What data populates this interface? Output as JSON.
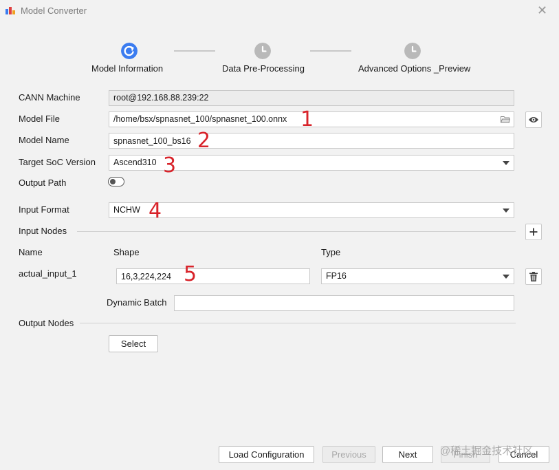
{
  "window": {
    "title": "Model Converter",
    "close_glyph": "✕"
  },
  "stepper": {
    "steps": [
      {
        "label": "Model Information",
        "state": "current",
        "icon": "current-step-icon"
      },
      {
        "label": "Data Pre-Processing",
        "state": "pending",
        "icon": "clock-icon"
      },
      {
        "label": "Advanced Options _Preview",
        "state": "pending",
        "icon": "clock-icon"
      }
    ]
  },
  "form": {
    "cann_machine": {
      "label": "CANN Machine",
      "value": "root@192.168.88.239:22"
    },
    "model_file": {
      "label": "Model File",
      "value": "/home/bsx/spnasnet_100/spnasnet_100.onnx"
    },
    "model_name": {
      "label": "Model Name",
      "value": "spnasnet_100_bs16"
    },
    "target_soc": {
      "label": "Target SoC Version",
      "value": "Ascend310"
    },
    "output_path": {
      "label": "Output Path",
      "enabled": false
    },
    "input_format": {
      "label": "Input Format",
      "value": "NCHW"
    },
    "input_nodes": {
      "label": "Input Nodes",
      "headers": {
        "name": "Name",
        "shape": "Shape",
        "type": "Type"
      },
      "rows": [
        {
          "name": "actual_input_1",
          "shape": "16,3,224,224",
          "type": "FP16"
        }
      ],
      "dynamic_batch": {
        "label": "Dynamic Batch",
        "value": ""
      }
    },
    "output_nodes": {
      "label": "Output Nodes",
      "select_label": "Select"
    }
  },
  "annotations": [
    "1",
    "2",
    "3",
    "4",
    "5"
  ],
  "footer": {
    "load_configuration": "Load Configuration",
    "previous": "Previous",
    "next": "Next",
    "finish": "Finish",
    "cancel": "Cancel"
  },
  "watermark": "@稀土掘金技术社区",
  "colors": {
    "accent": "#3b7cf0",
    "pending_step": "#b9b9b9",
    "annotation_red": "#d8232a",
    "background": "#f2f2f2"
  }
}
